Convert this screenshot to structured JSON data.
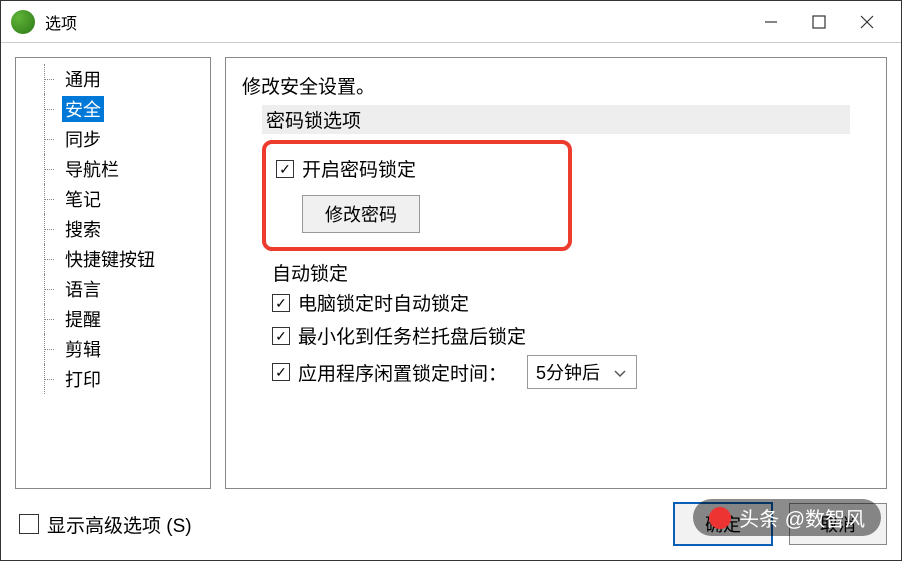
{
  "window": {
    "title": "选项"
  },
  "sidebar": {
    "items": [
      "通用",
      "安全",
      "同步",
      "导航栏",
      "笔记",
      "搜索",
      "快捷键按钮",
      "语言",
      "提醒",
      "剪辑",
      "打印"
    ],
    "selected_index": 1
  },
  "main": {
    "heading": "修改安全设置。",
    "password_section": "密码锁选项",
    "enable_password_lock": "开启密码锁定",
    "modify_password": "修改密码",
    "auto_lock_title": "自动锁定",
    "lock_when_screen": "电脑锁定时自动锁定",
    "lock_when_minimized": "最小化到任务栏托盘后锁定",
    "idle_lock_label": "应用程序闲置锁定时间：",
    "idle_lock_value": "5分钟后"
  },
  "footer": {
    "advanced": "显示高级选项 (S)",
    "ok": "确定",
    "cancel": "取消"
  },
  "watermark": "头条 @数智风"
}
